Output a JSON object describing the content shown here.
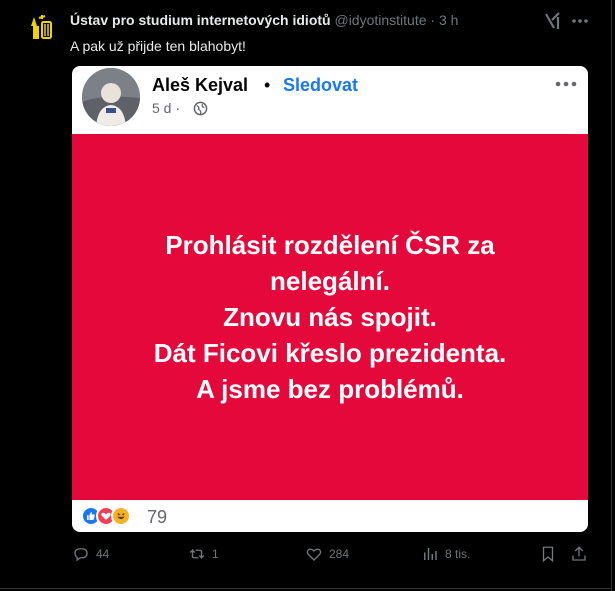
{
  "tweet": {
    "display_name": "Ústav pro studium internetových idiotů",
    "handle": "@idyotinstitute",
    "separator": "·",
    "time": "3 h",
    "text": "A pak už přijde ten blahobyt!"
  },
  "embedded_post": {
    "author": "Aleš Kejval",
    "dot": "•",
    "follow_label": "Sledovat",
    "time": "5 d",
    "time_sep": "·",
    "lines": [
      "Prohlásit rozdělení ČSR za",
      "nelegální.",
      "Znovu nás spojit.",
      "Dát Ficovi křeslo prezidenta.",
      "A jsme bez problémů."
    ],
    "reaction_count": "79",
    "background_color": "#e4093a",
    "follow_color": "#1877f2"
  },
  "actions": {
    "replies": "44",
    "reposts": "1",
    "likes": "284",
    "views": "8 tis."
  }
}
